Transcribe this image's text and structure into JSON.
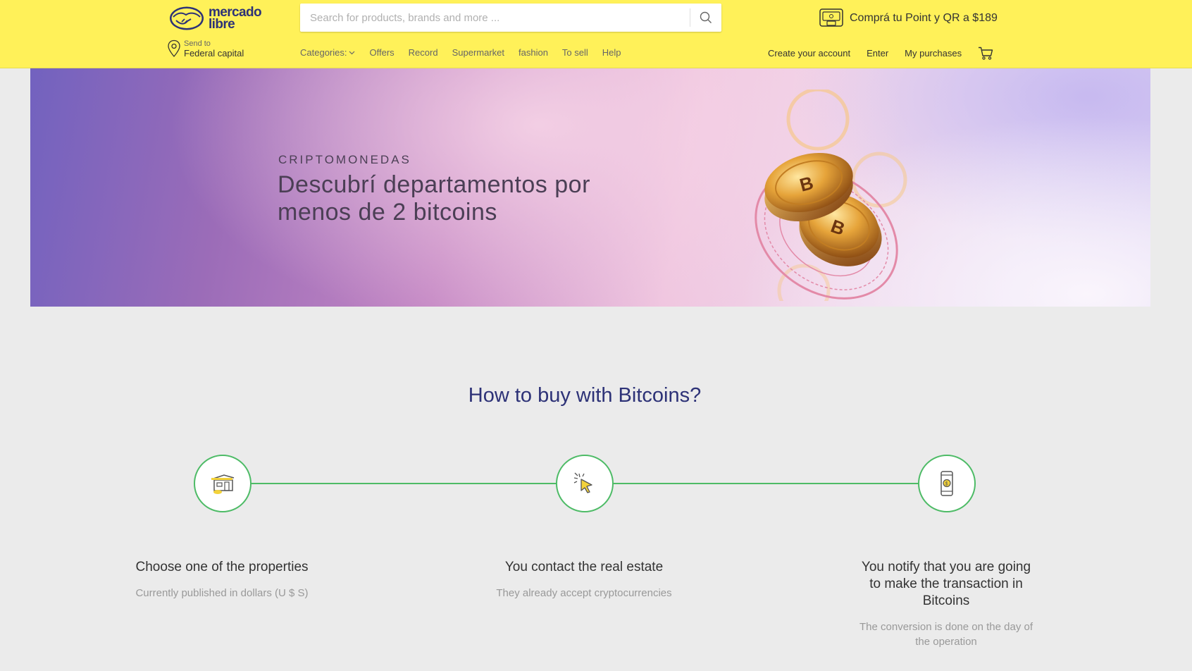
{
  "brand": {
    "line1": "mercado",
    "line2": "libre",
    "colors": {
      "header": "#fff159",
      "brand_blue": "#2d3277",
      "accent_green": "#4dbb66"
    }
  },
  "location": {
    "label": "Send to",
    "value": "Federal capital"
  },
  "search": {
    "placeholder": "Search for products, brands and more ...",
    "value": ""
  },
  "promo": {
    "text": "Comprá tu Point y QR a $189"
  },
  "nav": {
    "categories": "Categories:",
    "items": [
      "Offers",
      "Record",
      "Supermarket",
      "fashion",
      "To sell",
      "Help"
    ]
  },
  "user_nav": {
    "create_account": "Create your account",
    "enter": "Enter",
    "purchases": "My purchases"
  },
  "banner": {
    "kicker": "CRIPTOMONEDAS",
    "title": "Descubrí departamentos por menos de 2 bitcoins"
  },
  "how": {
    "title": "How to buy with Bitcoins?",
    "steps": [
      {
        "icon": "house-icon",
        "title": "Choose one of the properties",
        "desc": "Currently published in dollars (U $ S)"
      },
      {
        "icon": "cursor-click-icon",
        "title": "You contact the real estate",
        "desc": "They already accept cryptocurrencies"
      },
      {
        "icon": "phone-coin-icon",
        "title": "You notify that you are going to make the transaction in Bitcoins",
        "desc": "The conversion is done on the day of the operation"
      }
    ]
  }
}
